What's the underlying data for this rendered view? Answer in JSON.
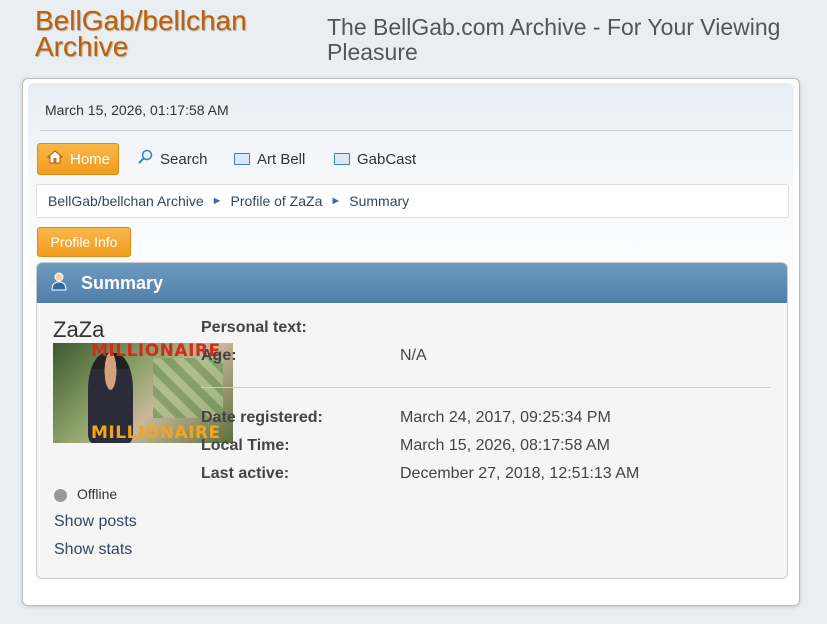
{
  "site": {
    "title_line1": "BellGab/bellchan",
    "title_line2": "Archive",
    "slogan_line1": "The BellGab.com Archive - For Your Viewing",
    "slogan_line2": "Pleasure"
  },
  "upper": {
    "datetime": "March 15, 2026, 01:17:58 AM"
  },
  "menu": {
    "home": "Home",
    "search": "Search",
    "artbell": "Art Bell",
    "gabcast": "GabCast"
  },
  "breadcrumb": {
    "items": [
      "BellGab/bellchan Archive",
      "Profile of ZaZa",
      "Summary"
    ],
    "separator": "►"
  },
  "profile_info_button": "Profile Info",
  "summary": {
    "header": "Summary",
    "username": "ZaZa",
    "avatar_caption_top": "MILLIONAIRE",
    "avatar_caption_bottom": "MILLIONAIRE",
    "fields": [
      {
        "label": "Personal text:",
        "value": ""
      },
      {
        "label": "Age:",
        "value": "N/A"
      },
      {
        "label": "Date registered:",
        "value": "March 24, 2017, 09:25:34 PM"
      },
      {
        "label": "Local Time:",
        "value": "March 15, 2026, 08:17:58 AM"
      },
      {
        "label": "Last active:",
        "value": "December 27, 2018, 12:51:13 AM"
      }
    ],
    "status": "Offline",
    "links": {
      "show_posts": "Show posts",
      "show_stats": "Show stats"
    }
  },
  "colors": {
    "accent_orange": "#f19c1d",
    "header_blue": "#5a87b0",
    "title_orange": "#c06002"
  }
}
